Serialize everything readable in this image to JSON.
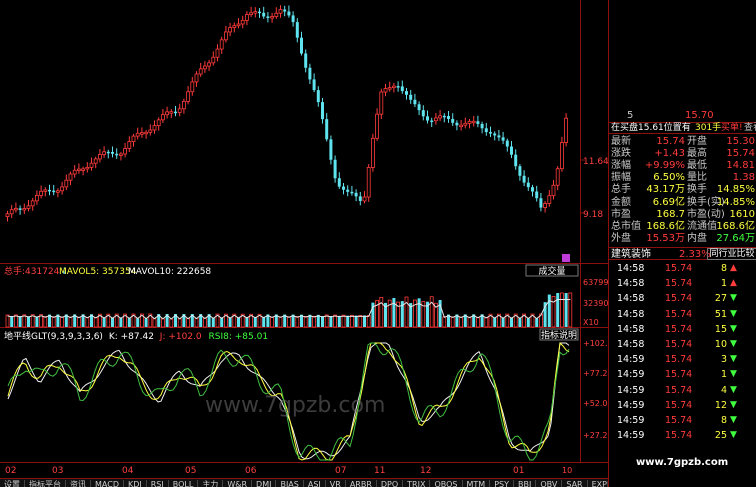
{
  "price_axis": {
    "labels": [
      "11.64",
      "9.18"
    ]
  },
  "date_axis": {
    "labels": [
      "02",
      "03",
      "04",
      "05",
      "06",
      "07",
      "11",
      "12",
      "01"
    ]
  },
  "volume": {
    "hand_label": "总手:",
    "hand_value": "431724",
    "mavol5": "MAVOL5: 357354",
    "mavol10": "MAVOL10: 222658",
    "button": "成交量",
    "axis_labels": [
      "63799",
      "32390",
      "X10"
    ]
  },
  "indicator": {
    "title": "地平线GLT(9,3,9,3,3,6)",
    "k": "K: +87.42",
    "j": "J: +102.0",
    "rsi": "RSI8: +85.01",
    "button": "指标说明",
    "axis_labels": [
      "+102.0",
      "+77.29",
      "+52.00",
      "+27.29"
    ]
  },
  "watermark": "www.7gpzb.com",
  "corner_label": "10",
  "tabs": [
    "设置",
    "指标平台",
    "资讯",
    "MACD",
    "KDJ",
    "RSI",
    "BOLL",
    "主力",
    "W&R",
    "DMI",
    "BIAS",
    "ASI",
    "VR",
    "ARBR",
    "DPO",
    "TRIX",
    "OBOS",
    "MTM",
    "PSY",
    "BBI",
    "OBV",
    "SAR",
    "EXPMA",
    "地平线GLT"
  ],
  "side": {
    "top_row": {
      "left": "5",
      "right": "15.70"
    },
    "order_line": {
      "label": "在买盘15.61位置有",
      "count": "301手",
      "buy": "买单!",
      "detail": "查看详细"
    },
    "quotes": [
      {
        "l1": "最新",
        "v1": "15.74",
        "l2": "开盘",
        "v2": "15.30",
        "c1": "#ff3b3b",
        "c2": "#ff3b3b"
      },
      {
        "l1": "涨跌",
        "v1": "+1.43",
        "l2": "最高",
        "v2": "15.74",
        "c1": "#ff3b3b",
        "c2": "#ff3b3b"
      },
      {
        "l1": "涨幅",
        "v1": "+9.99%",
        "l2": "最低",
        "v2": "14.81",
        "c1": "#ff3b3b",
        "c2": "#ff3b3b"
      },
      {
        "l1": "振幅",
        "v1": "6.50%",
        "l2": "量比",
        "v2": "1.38",
        "c1": "#ffff40",
        "c2": "#ff3b3b"
      },
      {
        "l1": "总手",
        "v1": "43.17万",
        "l2": "换手",
        "v2": "14.85%",
        "c1": "#ffff40",
        "c2": "#ffff40"
      },
      {
        "l1": "金额",
        "v1": "6.69亿",
        "l2": "换手(实)",
        "v2": "14.85%",
        "c1": "#ffff40",
        "c2": "#ffff40"
      },
      {
        "l1": "市盈",
        "v1": "168.7",
        "l2": "市盈(动)",
        "v2": "1610",
        "c1": "#ffff40",
        "c2": "#ffff40"
      },
      {
        "l1": "总市值",
        "v1": "168.6亿",
        "l2": "流通值",
        "v2": "168.6亿",
        "c1": "#ffff40",
        "c2": "#ffff40"
      },
      {
        "l1": "外盘",
        "v1": "15.53万",
        "l2": "内盘",
        "v2": "27.64万",
        "c1": "#ff3b3b",
        "c2": "#40ff40"
      }
    ],
    "sector": {
      "name": "建筑装饰",
      "pct": "2.33%",
      "compare": "同行业比较"
    },
    "ticks": [
      {
        "time": "14:58",
        "price": "15.74",
        "vol": "8",
        "dir": "up"
      },
      {
        "time": "14:58",
        "price": "15.74",
        "vol": "1",
        "dir": "up"
      },
      {
        "time": "14:58",
        "price": "15.74",
        "vol": "27",
        "dir": "down"
      },
      {
        "time": "14:58",
        "price": "15.74",
        "vol": "51",
        "dir": "down"
      },
      {
        "time": "14:58",
        "price": "15.74",
        "vol": "15",
        "dir": "down"
      },
      {
        "time": "14:58",
        "price": "15.74",
        "vol": "10",
        "dir": "down"
      },
      {
        "time": "14:59",
        "price": "15.74",
        "vol": "3",
        "dir": "down"
      },
      {
        "time": "14:59",
        "price": "15.74",
        "vol": "1",
        "dir": "down"
      },
      {
        "time": "14:59",
        "price": "15.74",
        "vol": "4",
        "dir": "down"
      },
      {
        "time": "14:59",
        "price": "15.74",
        "vol": "12",
        "dir": "down"
      },
      {
        "time": "14:59",
        "price": "15.74",
        "vol": "8",
        "dir": "down"
      },
      {
        "time": "14:59",
        "price": "15.74",
        "vol": "25",
        "dir": "down"
      }
    ]
  },
  "colors": {
    "up": "#ff3b3b",
    "down": "#5fe3ee",
    "frame": "#8a1010",
    "yellow": "#ffff40",
    "green": "#40ff40"
  }
}
